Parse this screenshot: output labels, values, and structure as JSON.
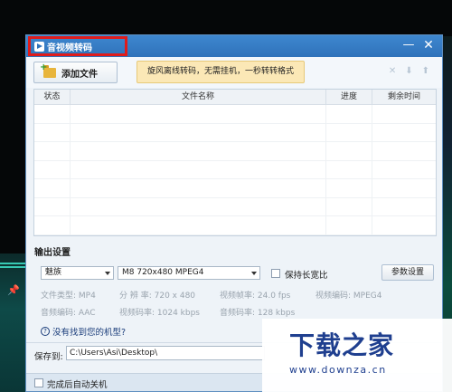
{
  "window": {
    "title": "音视频转码",
    "min_glyph": "—",
    "close_glyph": "✕"
  },
  "toolbar": {
    "add_file_label": "添加文件",
    "promo_text": "旋风离线转码，无需挂机，一秒转转格式",
    "icons": [
      "delete-icon",
      "move-down-icon",
      "move-up-icon"
    ],
    "delete_glyph": "✕",
    "down_glyph": "⬇",
    "up_glyph": "⬆"
  },
  "table": {
    "columns": [
      "状态",
      "文件名称",
      "进度",
      "剩余时间"
    ],
    "row_count": 7
  },
  "output": {
    "section_title": "输出设置",
    "brand_value": "魅族",
    "model_value": "M8 720x480 MPEG4",
    "keep_aspect_label": "保持长宽比",
    "param_button": "参数设置",
    "file_type": "文件类型:  MP4",
    "resolution": "分 辨 率:  720 x 480",
    "video_fps": "视频帧率:  24.0 fps",
    "video_codec": "视频编码:  MPEG4",
    "audio_codec": "音频编码:  AAC",
    "video_bitrate": "视频码率:  1024 kbps",
    "audio_bitrate": "音频码率:  128 kbps",
    "help_text": "没有找到您的机型?",
    "help_glyph": "?"
  },
  "save": {
    "label": "保存到:",
    "path": "C:\\Users\\Asi\\Desktop\\"
  },
  "bottom": {
    "shutdown_label": "完成后自动关机"
  },
  "watermark": {
    "title": "下载之家",
    "url": "www.downza.cn"
  },
  "colors": {
    "titlebar": "#2f72ba",
    "highlight_box": "#e01b1b",
    "promo_bg": "#fbe8b6",
    "watermark_text": "#1f3f8f"
  }
}
